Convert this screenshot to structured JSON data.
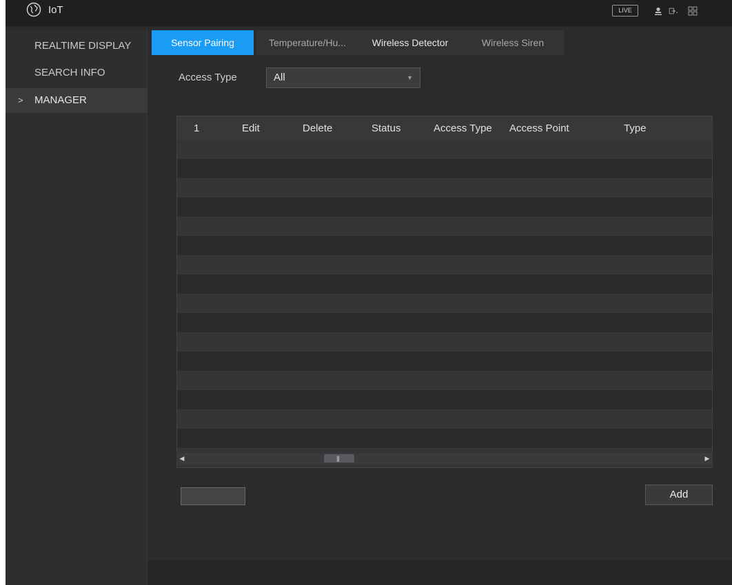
{
  "header": {
    "app_title": "IoT",
    "live_label": "LIVE",
    "icons": [
      "globe-icon",
      "user-icon",
      "logout-icon",
      "menu-grid-icon"
    ]
  },
  "sidebar": {
    "items": [
      {
        "label": "REALTIME DISPLAY"
      },
      {
        "label": "SEARCH INFO"
      },
      {
        "label": "MANAGER",
        "marker": ">"
      }
    ]
  },
  "tabs": [
    {
      "label": "Sensor Pairing"
    },
    {
      "label": "Temperature/Hu..."
    },
    {
      "label": "Wireless Detector"
    },
    {
      "label": "Wireless Siren"
    }
  ],
  "filter": {
    "label": "Access Type",
    "value": "All"
  },
  "table": {
    "columns": [
      "1",
      "Edit",
      "Delete",
      "Status",
      "Access Type",
      "Access Point",
      "Type"
    ],
    "rows": []
  },
  "actions": {
    "add_label": "Add"
  },
  "colors": {
    "accent": "#1a9cf4",
    "background": "#2b2b2d",
    "text": "#e0e0e0"
  }
}
